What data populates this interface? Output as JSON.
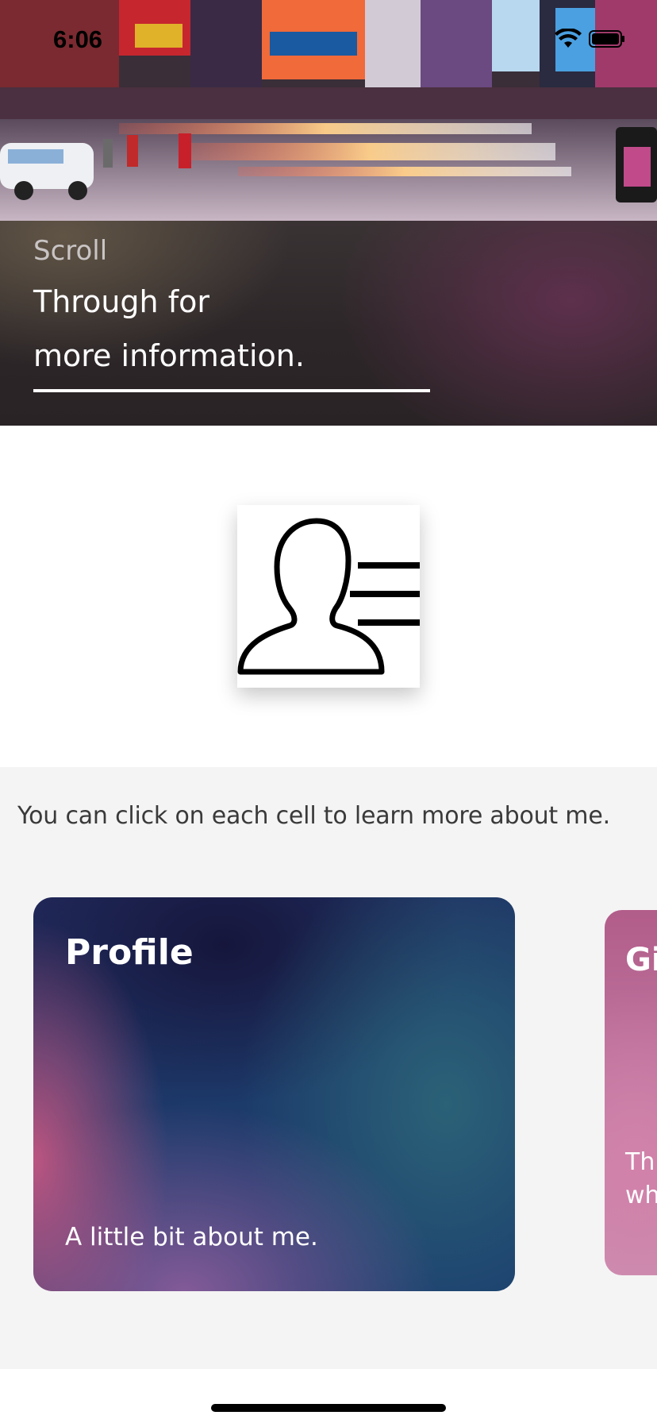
{
  "status_bar": {
    "time": "6:06",
    "icons": [
      "wifi-icon",
      "battery-icon"
    ]
  },
  "hero": {
    "image": "city-street-photo",
    "kicker": "Scroll",
    "title_line1": "Through for",
    "title_line2": "more information."
  },
  "avatar": {
    "icon": "profile-card-icon"
  },
  "section": {
    "caption": "You can click on each cell to learn more about me."
  },
  "cards": [
    {
      "title": "Profile",
      "subtitle": "A little bit about me."
    },
    {
      "title": "Gi",
      "line1": "This",
      "line2": "whe"
    }
  ],
  "colors": {
    "banner_dark": "#2c2628",
    "card_profile_primary": "#1c3a6a",
    "card_profile_accent": "#c45682",
    "card_peek": "#c17aa3",
    "section_bg": "#f4f4f4"
  }
}
